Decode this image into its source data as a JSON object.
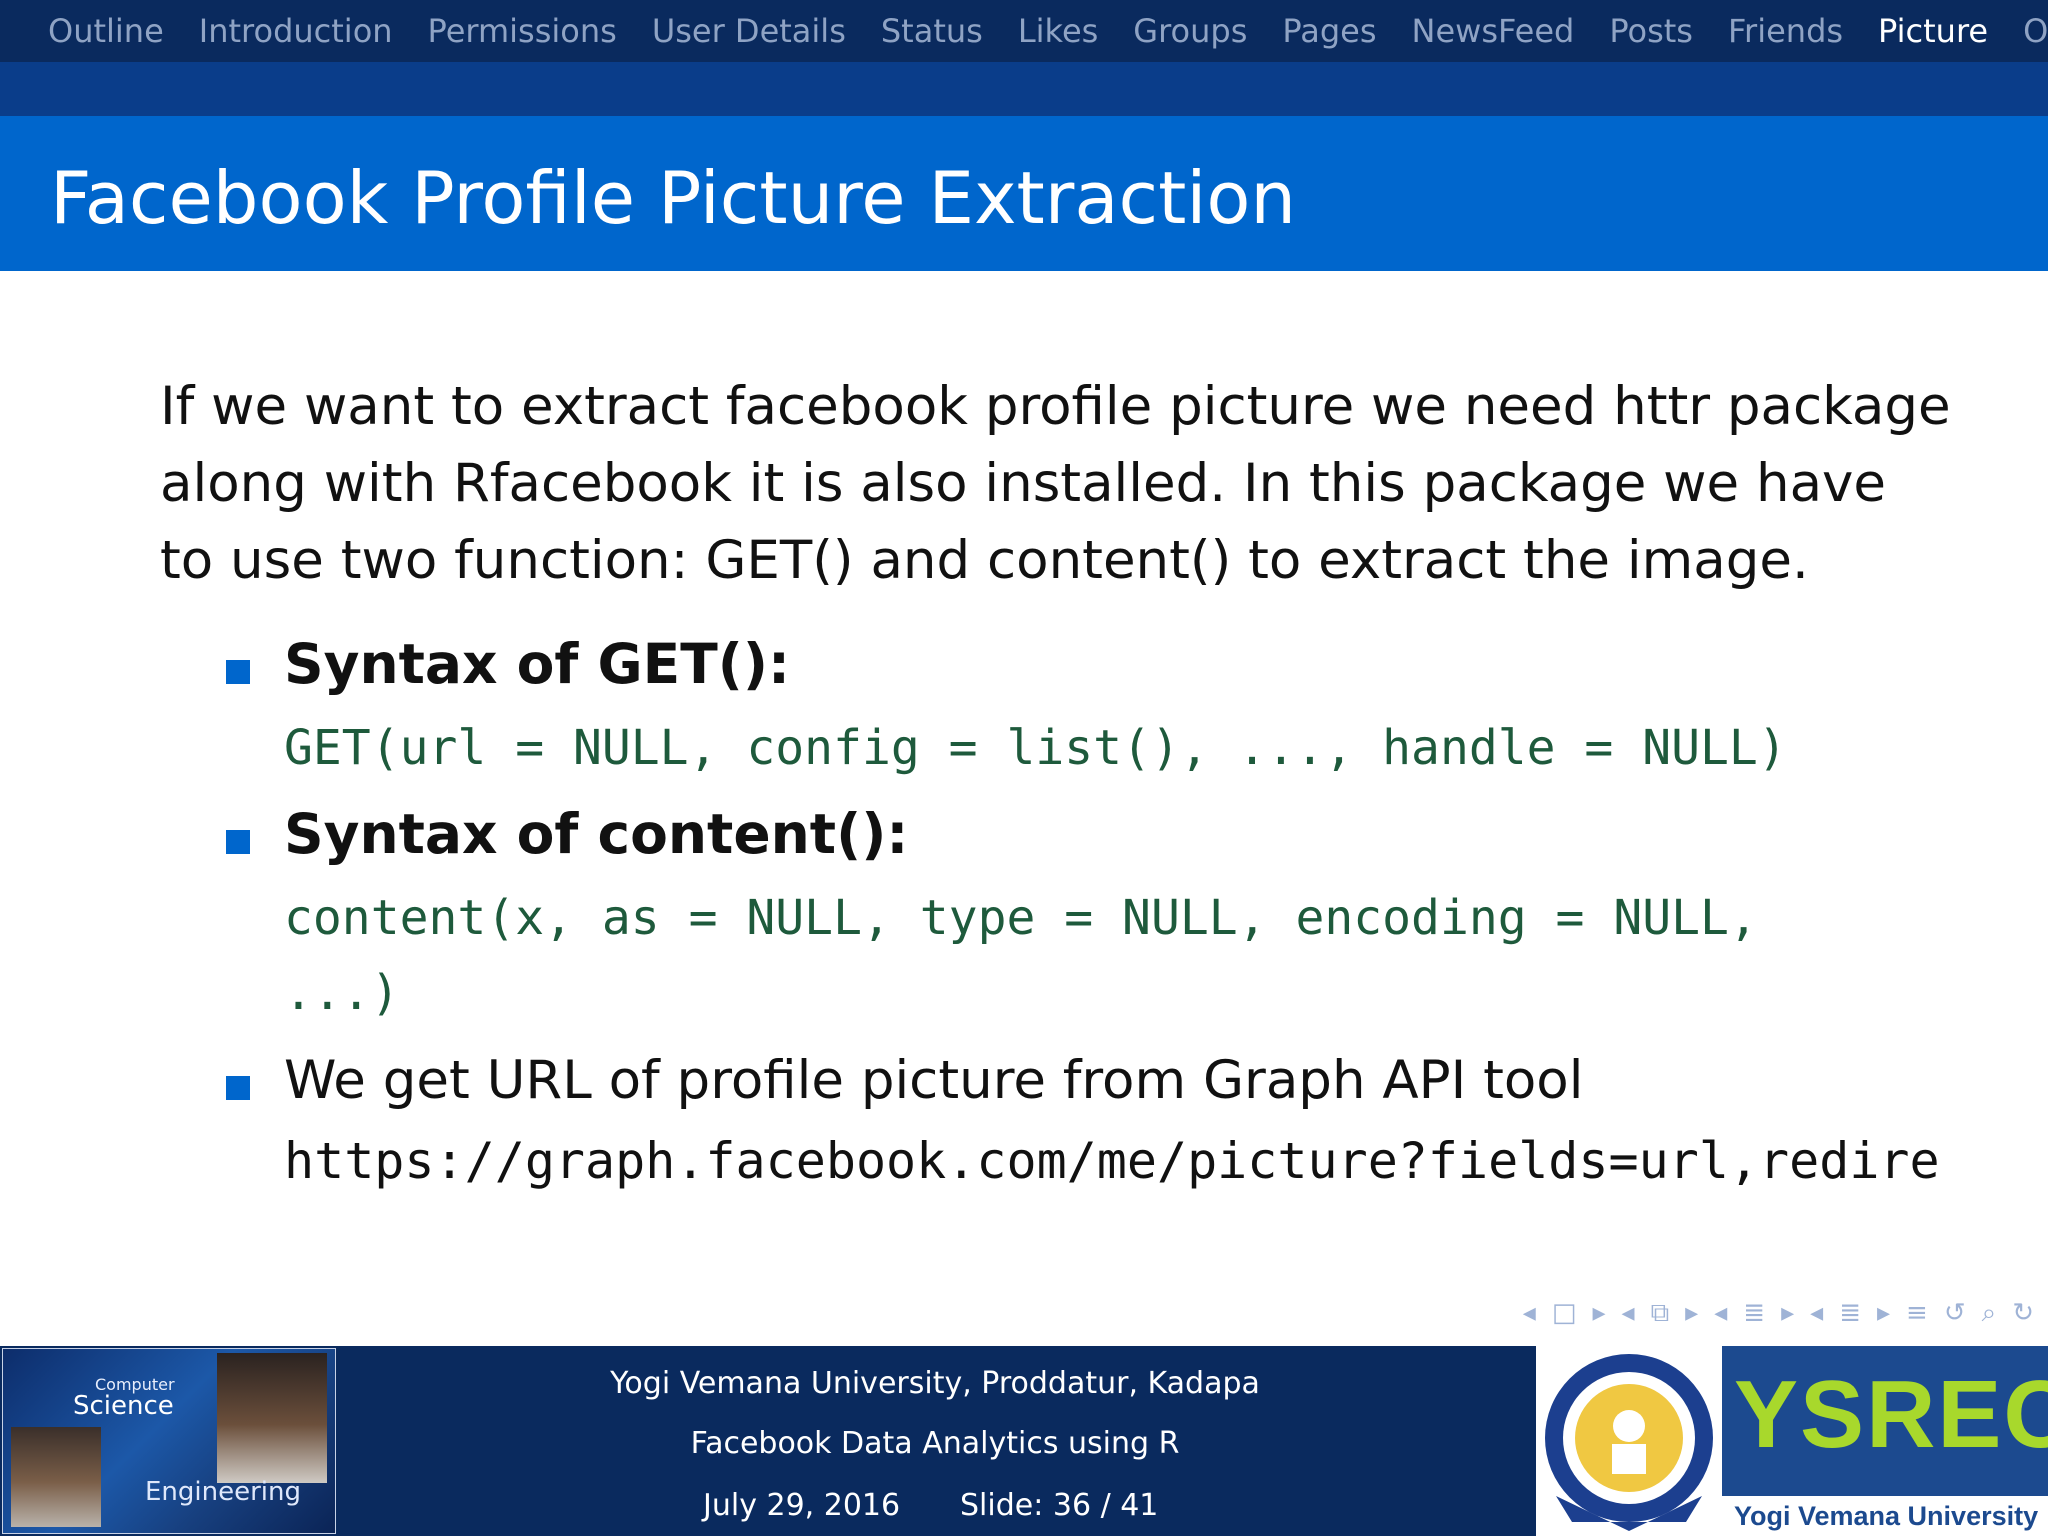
{
  "nav": {
    "items": [
      {
        "label": "Outline"
      },
      {
        "label": "Introduction"
      },
      {
        "label": "Permissions"
      },
      {
        "label": "User Details"
      },
      {
        "label": "Status"
      },
      {
        "label": "Likes"
      },
      {
        "label": "Groups"
      },
      {
        "label": "Pages"
      },
      {
        "label": "NewsFeed"
      },
      {
        "label": "Posts"
      },
      {
        "label": "Friends"
      },
      {
        "label": "Picture"
      },
      {
        "label": "Others"
      }
    ],
    "active": "Picture"
  },
  "slide": {
    "title": "Facebook Profile Picture Extraction",
    "intro_lines": [
      "If we want to extract facebook profile picture we need httr package",
      "along with Rfacebook it is also installed. In this package we have",
      "to use two function: GET() and content() to extract the image."
    ],
    "bullets": [
      {
        "heading": "Syntax of GET():",
        "code_lines": [
          "GET(url = NULL, config = list(), ..., handle = NULL)"
        ]
      },
      {
        "heading": "Syntax of content():",
        "code_lines": [
          "content(x, as = NULL, type = NULL, encoding = NULL,",
          "...)"
        ]
      },
      {
        "text": "We get URL of profile picture from Graph API tool",
        "url": "https://graph.facebook.com/me/picture?fields=url,redire"
      }
    ]
  },
  "footer": {
    "university": "Yogi Vemana University, Proddatur, Kadapa",
    "course": "Facebook Data Analytics using R",
    "date": "July 29, 2016",
    "slide_label": "Slide: 36 / 41",
    "slide_current": 36,
    "slide_total": 41,
    "logo_text": {
      "computer": "Computer",
      "science": "Science",
      "engineering": "Engineering"
    },
    "ysrec": "YSREC",
    "ysrec_sub": "Yogi Vemana University"
  },
  "nav_controls": [
    "nav-prev-frame-icon",
    "frame-icon",
    "nav-next-frame-icon",
    "nav-prev-subsection-icon",
    "subsection-icon",
    "nav-next-subsection-icon",
    "nav-prev-section-icon",
    "section-icon",
    "nav-next-section-icon",
    "nav-prev-slide-icon",
    "slide-icon",
    "nav-next-slide-icon",
    "document-icon",
    "back-icon",
    "search-icon",
    "forward-icon"
  ],
  "colors": {
    "navbar": "#0a2a5e",
    "titlebar": "#0066cc",
    "bullet": "#0066cc",
    "code": "#1e5a3c"
  }
}
